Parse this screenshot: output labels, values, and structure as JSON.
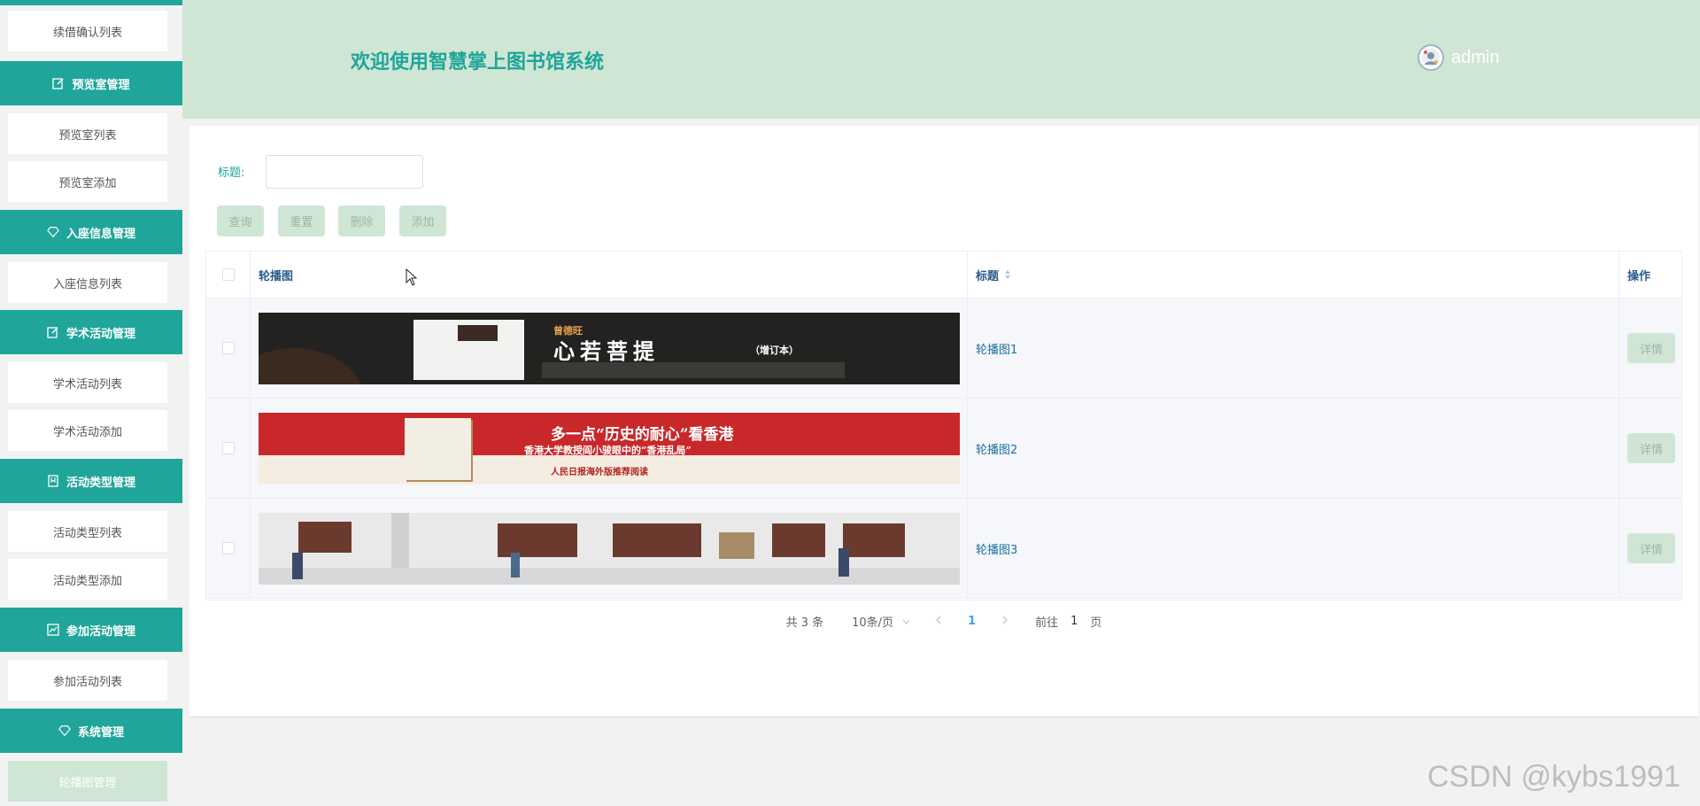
{
  "sidebar": {
    "items": [
      {
        "type": "item",
        "label": "续借确认列表"
      },
      {
        "type": "header",
        "label": "预览室管理",
        "icon": "edit-icon"
      },
      {
        "type": "item",
        "label": "预览室列表"
      },
      {
        "type": "item",
        "label": "预览室添加"
      },
      {
        "type": "header",
        "label": "入座信息管理",
        "icon": "diamond-icon"
      },
      {
        "type": "item",
        "label": "入座信息列表"
      },
      {
        "type": "header",
        "label": "学术活动管理",
        "icon": "edit-icon"
      },
      {
        "type": "item",
        "label": "学术活动列表"
      },
      {
        "type": "item",
        "label": "学术活动添加"
      },
      {
        "type": "header",
        "label": "活动类型管理",
        "icon": "bookmark-icon"
      },
      {
        "type": "item",
        "label": "活动类型列表"
      },
      {
        "type": "item",
        "label": "活动类型添加"
      },
      {
        "type": "header",
        "label": "参加活动管理",
        "icon": "chart-icon"
      },
      {
        "type": "item",
        "label": "参加活动列表"
      },
      {
        "type": "header",
        "label": "系统管理",
        "icon": "diamond-icon"
      },
      {
        "type": "item",
        "label": "轮播图管理",
        "active": true
      }
    ]
  },
  "header": {
    "title": "欢迎使用智慧掌上图书馆系统",
    "username": "admin"
  },
  "search": {
    "label": "标题:",
    "value": "",
    "placeholder": ""
  },
  "toolbar": {
    "query": "查询",
    "reset": "重置",
    "delete": "删除",
    "add": "添加"
  },
  "table": {
    "columns": {
      "image": "轮播图",
      "title": "标题",
      "actions": "操作"
    },
    "rows": [
      {
        "title": "轮播图1",
        "detail": "详情",
        "banner": {
          "bg": "#232220",
          "texts": [
            "曾德旺",
            "心若菩提",
            "（增订本）"
          ]
        }
      },
      {
        "title": "轮播图2",
        "detail": "详情",
        "banner": {
          "bg": "#c8282a",
          "texts": [
            "多一点“历史的耐心”看香港",
            "香港大学教授阎小骏眼中的“香港乱局”",
            "人民日报海外版推荐阅读"
          ]
        }
      },
      {
        "title": "轮播图3",
        "detail": "详情",
        "banner": {
          "bg": "#e9e9e9",
          "texts": []
        }
      }
    ]
  },
  "pagination": {
    "total": "共 3 条",
    "page_size": "10条/页",
    "current": "1",
    "goto_label": "前往",
    "goto_value": "1",
    "page_suffix": "页"
  },
  "watermark": "CSDN @kybs1991",
  "colors": {
    "accent": "#1fa59a",
    "header_bg": "#cfe6d4",
    "active_item": "#cfe6d4"
  }
}
